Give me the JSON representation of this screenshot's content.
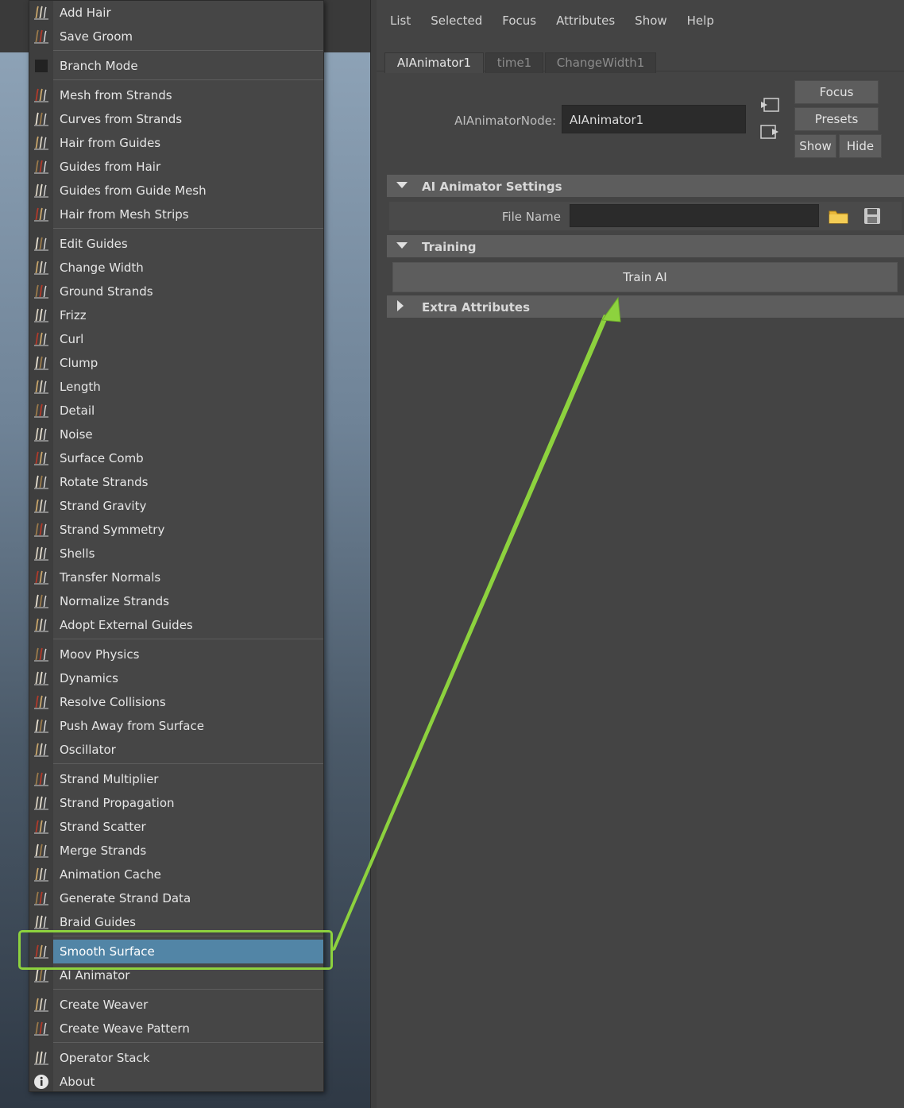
{
  "menu": {
    "items": [
      {
        "label": "Add Hair",
        "icon": "add-hair-icon"
      },
      {
        "label": "Save Groom",
        "icon": "save-groom-icon"
      },
      {
        "label": "Branch Mode",
        "icon": "branch-mode-icon"
      },
      {
        "label": "Mesh from Strands",
        "icon": "mesh-from-strands-icon"
      },
      {
        "label": "Curves from Strands",
        "icon": "curves-from-strands-icon"
      },
      {
        "label": "Hair from Guides",
        "icon": "hair-from-guides-icon"
      },
      {
        "label": "Guides from Hair",
        "icon": "guides-from-hair-icon"
      },
      {
        "label": "Guides from Guide Mesh",
        "icon": "guides-from-guide-mesh-icon"
      },
      {
        "label": "Hair from Mesh Strips",
        "icon": "hair-from-mesh-strips-icon"
      },
      {
        "label": "Edit Guides",
        "icon": "edit-guides-icon"
      },
      {
        "label": "Change Width",
        "icon": "change-width-icon"
      },
      {
        "label": "Ground Strands",
        "icon": "ground-strands-icon"
      },
      {
        "label": "Frizz",
        "icon": "frizz-icon"
      },
      {
        "label": "Curl",
        "icon": "curl-icon"
      },
      {
        "label": "Clump",
        "icon": "clump-icon"
      },
      {
        "label": "Length",
        "icon": "length-icon"
      },
      {
        "label": "Detail",
        "icon": "detail-icon"
      },
      {
        "label": "Noise",
        "icon": "noise-icon"
      },
      {
        "label": "Surface Comb",
        "icon": "surface-comb-icon"
      },
      {
        "label": "Rotate Strands",
        "icon": "rotate-strands-icon"
      },
      {
        "label": "Strand Gravity",
        "icon": "strand-gravity-icon"
      },
      {
        "label": "Strand Symmetry",
        "icon": "strand-symmetry-icon"
      },
      {
        "label": "Shells",
        "icon": "shells-icon"
      },
      {
        "label": "Transfer Normals",
        "icon": "transfer-normals-icon"
      },
      {
        "label": "Normalize Strands",
        "icon": "normalize-strands-icon"
      },
      {
        "label": "Adopt External Guides",
        "icon": "adopt-external-guides-icon"
      },
      {
        "label": "Moov Physics",
        "icon": "moov-physics-icon"
      },
      {
        "label": "Dynamics",
        "icon": "dynamics-icon"
      },
      {
        "label": "Resolve Collisions",
        "icon": "resolve-collisions-icon"
      },
      {
        "label": "Push Away from Surface",
        "icon": "push-away-from-surface-icon"
      },
      {
        "label": "Oscillator",
        "icon": "oscillator-icon"
      },
      {
        "label": "Strand Multiplier",
        "icon": "strand-multiplier-icon"
      },
      {
        "label": "Strand Propagation",
        "icon": "strand-propagation-icon"
      },
      {
        "label": "Strand Scatter",
        "icon": "strand-scatter-icon"
      },
      {
        "label": "Merge Strands",
        "icon": "merge-strands-icon"
      },
      {
        "label": "Animation Cache",
        "icon": "animation-cache-icon"
      },
      {
        "label": "Generate Strand Data",
        "icon": "generate-strand-data-icon"
      },
      {
        "label": "Braid Guides",
        "icon": "braid-guides-icon"
      },
      {
        "label": "Smooth Surface",
        "icon": "smooth-surface-icon"
      },
      {
        "label": "AI Animator",
        "icon": "ai-animator-icon"
      },
      {
        "label": "Create Weaver",
        "icon": "create-weaver-icon"
      },
      {
        "label": "Create Weave Pattern",
        "icon": "create-weave-pattern-icon"
      },
      {
        "label": "Operator Stack",
        "icon": "operator-stack-icon"
      },
      {
        "label": "About",
        "icon": "about-icon"
      }
    ],
    "highlighted_item": "Smooth Surface",
    "highlight_color": "#5285a6"
  },
  "menubar": {
    "items": [
      "List",
      "Selected",
      "Focus",
      "Attributes",
      "Show",
      "Help"
    ]
  },
  "tabs": [
    "AIAnimator1",
    "time1",
    "ChangeWidth1"
  ],
  "active_tab": "AIAnimator1",
  "node": {
    "label": "AIAnimatorNode:",
    "value": "AIAnimator1"
  },
  "buttons": {
    "focus": "Focus",
    "presets": "Presets",
    "show": "Show",
    "hide": "Hide",
    "train": "Train AI"
  },
  "sections": {
    "ai_animator_settings": "AI Animator Settings",
    "training": "Training",
    "extra_attributes": "Extra Attributes"
  },
  "file": {
    "label": "File Name",
    "value": ""
  },
  "icons": {
    "folder": "folder-icon",
    "save": "save-icon",
    "input": "input-connection-icon",
    "output": "output-connection-icon"
  },
  "annotation_color": "#8dd23e"
}
